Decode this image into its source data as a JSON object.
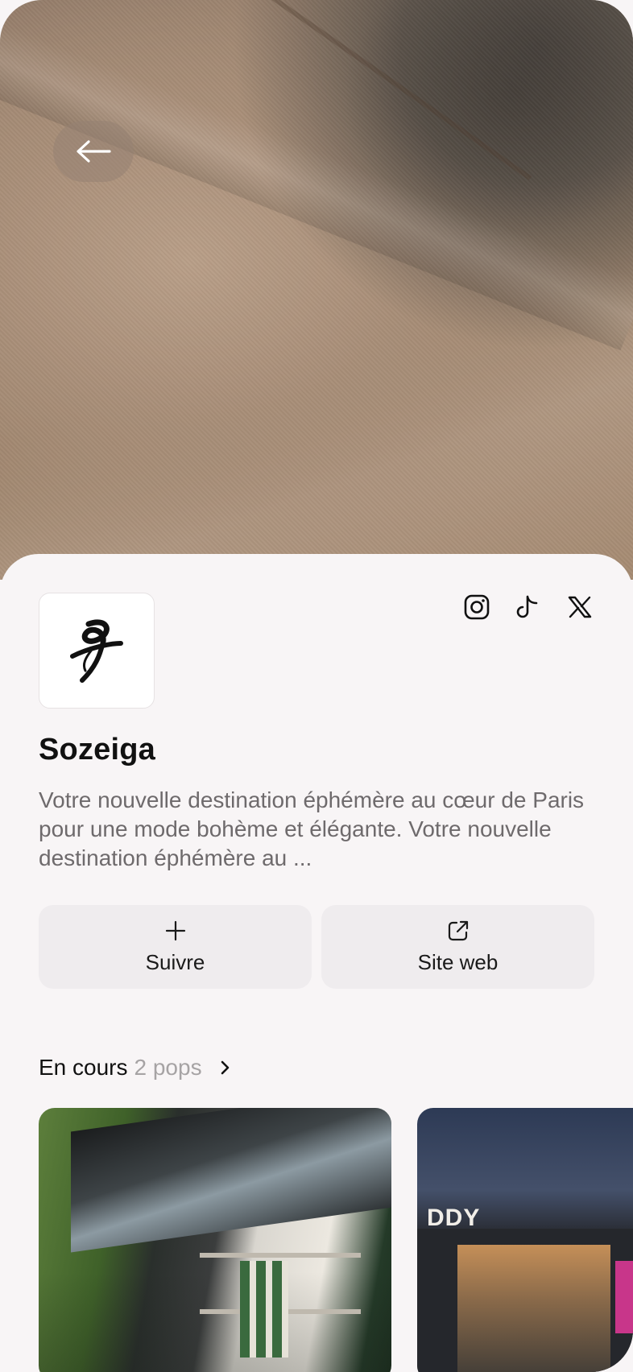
{
  "nav": {
    "back_icon": "arrow-left-icon"
  },
  "brand": {
    "logo_icon": "brush-stroke-logo",
    "name": "Sozeiga",
    "description": "Votre nouvelle destination éphémère au cœur de Paris pour une mode bohème et élégante. Votre nouvelle destination éphémère au ..."
  },
  "socials": [
    {
      "icon": "instagram-icon"
    },
    {
      "icon": "tiktok-icon"
    },
    {
      "icon": "x-icon"
    }
  ],
  "actions": {
    "follow": {
      "icon": "plus-icon",
      "label": "Suivre"
    },
    "website": {
      "icon": "external-link-icon",
      "label": "Site web"
    }
  },
  "section": {
    "title": "En cours",
    "count": "2 pops",
    "icon": "chevron-right-icon"
  },
  "cards": [
    {
      "image": "glass-kiosk-shop-green-clothes"
    },
    {
      "image": "container-popup-store-night",
      "sign": "DDY"
    }
  ],
  "colors": {
    "background": "#f8f5f6",
    "button_bg": "#efecee",
    "muted_text": "#6e6a6c",
    "count_text": "#a6a3a4"
  }
}
